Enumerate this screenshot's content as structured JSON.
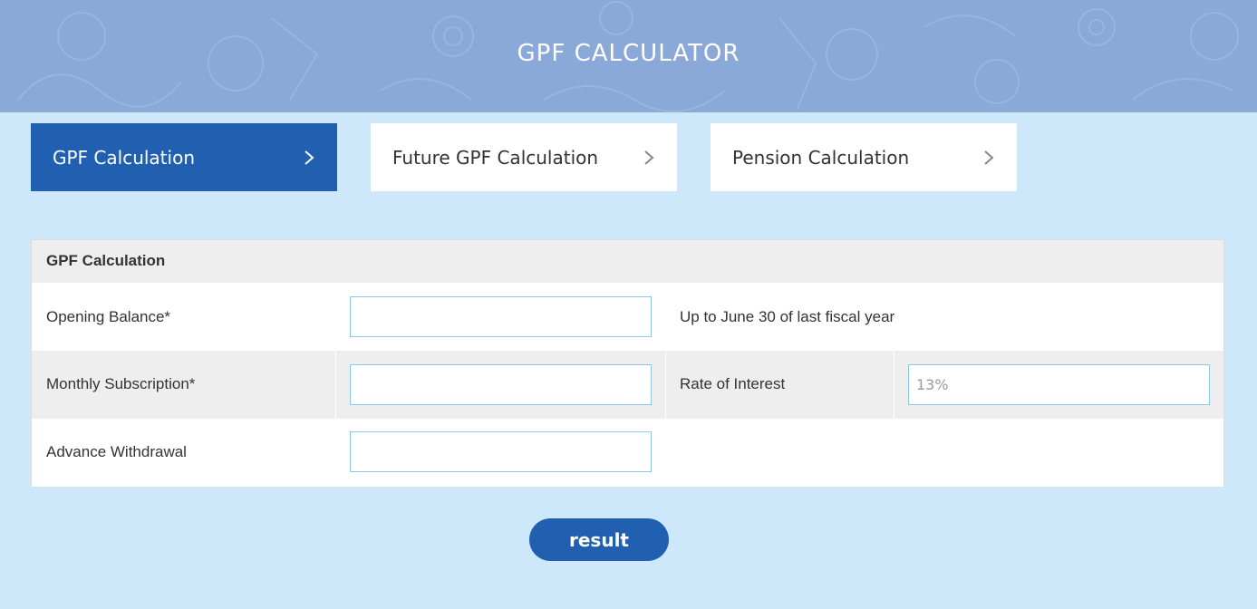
{
  "header": {
    "title": "GPF CALCULATOR"
  },
  "tabs": [
    {
      "label": "GPF Calculation",
      "active": true
    },
    {
      "label": "Future GPF Calculation",
      "active": false
    },
    {
      "label": "Pension Calculation",
      "active": false
    }
  ],
  "form": {
    "title": "GPF Calculation",
    "opening_balance": {
      "label": "Opening Balance*",
      "value": "",
      "note": "Up to June 30 of last fiscal year"
    },
    "monthly_subscription": {
      "label": "Monthly Subscription*",
      "value": ""
    },
    "rate_of_interest": {
      "label": "Rate of Interest",
      "placeholder": "13%"
    },
    "advance_withdrawal": {
      "label": "Advance Withdrawal",
      "value": ""
    }
  },
  "actions": {
    "result_label": "result"
  },
  "colors": {
    "header_bg": "#8aa9d8",
    "page_bg": "#cde7fb",
    "accent": "#215fb0"
  },
  "icons": {
    "tab_chevron": "chevron-right-icon"
  }
}
